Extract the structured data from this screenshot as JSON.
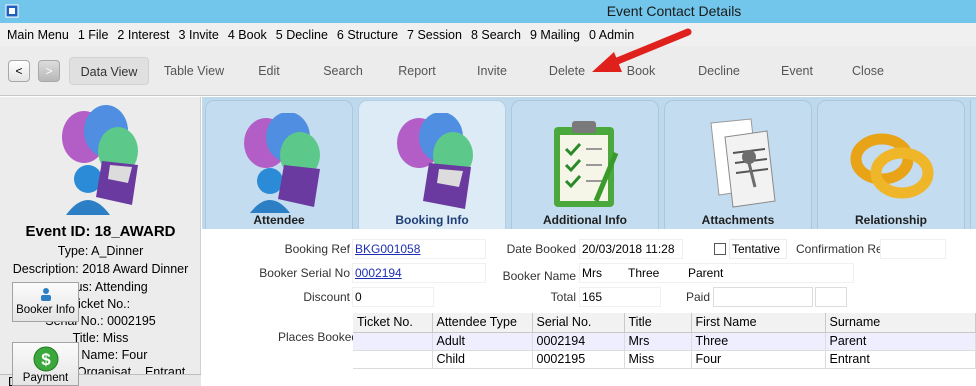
{
  "window": {
    "title": "Event Contact Details"
  },
  "menu": [
    "Main Menu",
    "1 File",
    "2 Interest",
    "3 Invite",
    "4 Book",
    "5 Decline",
    "6 Structure",
    "7 Session",
    "8 Search",
    "9 Mailing",
    "0 Admin"
  ],
  "toolbar": {
    "prev": "<",
    "next": ">",
    "buttons": [
      "Data View",
      "Table View",
      "Edit",
      "Search",
      "Report",
      "Invite",
      "Delete",
      "Book",
      "Decline",
      "Event",
      "Close"
    ]
  },
  "left_panel": {
    "event_id": "Event ID: 18_AWARD",
    "lines": [
      "Type: A_Dinner",
      "Description: 2018 Award Dinner",
      "Status: Attending",
      "Ticket No.:",
      "Serial No.: 0002195",
      "Title: Miss",
      "First Name: Four",
      "Surname / Organisat... Entrant"
    ],
    "data_tab": "Data"
  },
  "tabs": [
    "Attendee",
    "Booking Info",
    "Additional Info",
    "Attachments",
    "Relationship"
  ],
  "form": {
    "booking_ref_label": "Booking Ref",
    "booking_ref": "BKG001058",
    "date_booked_label": "Date Booked",
    "date_booked": "20/03/2018 11:28",
    "tentative_label": "Tentative",
    "confirmation_ref_label": "Confirmation Ref",
    "confirmation_ref": "",
    "booker_serial_label": "Booker Serial No",
    "booker_serial": "0002194",
    "booker_name_label": "Booker Name",
    "booker_title": "Mrs",
    "booker_first": "Three",
    "booker_last": "Parent",
    "discount_label": "Discount",
    "discount": "0",
    "total_label": "Total",
    "total": "165",
    "paid_label": "Paid",
    "paid": "",
    "booker_info_button": "Booker Info",
    "payment_button": "Payment",
    "places_booked_label": "Places Booked"
  },
  "places_table": {
    "columns": [
      "Ticket No.",
      "Attendee Type",
      "Serial No.",
      "Title",
      "First Name",
      "Surname"
    ],
    "rows": [
      [
        "",
        "Adult",
        "0002194",
        "Mrs",
        "Three",
        "Parent"
      ],
      [
        "",
        "Child",
        "0002195",
        "Miss",
        "Four",
        "Entrant"
      ]
    ]
  },
  "colors": {
    "titlebar": "#72c5eb",
    "tab_area": "#bfd9ec",
    "arrow": "#e0201b",
    "link": "#1f2fb0"
  }
}
